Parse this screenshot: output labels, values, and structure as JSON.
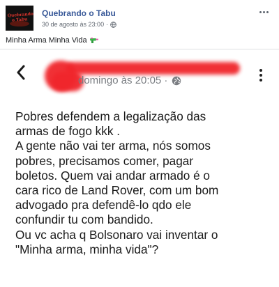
{
  "post": {
    "page_name": "Quebrando o Tabu",
    "timestamp": "30 de agosto às 23:00",
    "separator": "·",
    "caption": "Minha Arma Minha Vida",
    "avatar_text": "Quebrando o Tabu",
    "icons": {
      "globe": "globe-icon",
      "more": "more-options-icon",
      "caption_emoji": "water-gun-icon"
    }
  },
  "screenshot": {
    "time": "domingo às 20:05 ·",
    "icons": {
      "back": "back-arrow-icon",
      "globe": "globe-icon",
      "more": "more-options-icon"
    },
    "redaction_color": "#f0262c",
    "body_text": "Pobres defendem a legalização das\narmas de fogo kkk .\nA gente não vai ter arma, nós somos\npobres, precisamos comer, pagar\nboletos. Quem vai andar armado é o\ncara rico de Land Rover, com um bom\nadvogado pra defendê-lo qdo ele\nconfundir tu com bandido.\nOu vc acha q Bolsonaro vai inventar o\n\"Minha arma, minha vida\"?"
  },
  "colors": {
    "link": "#385898",
    "meta": "#606770",
    "text": "#1c1e21"
  }
}
